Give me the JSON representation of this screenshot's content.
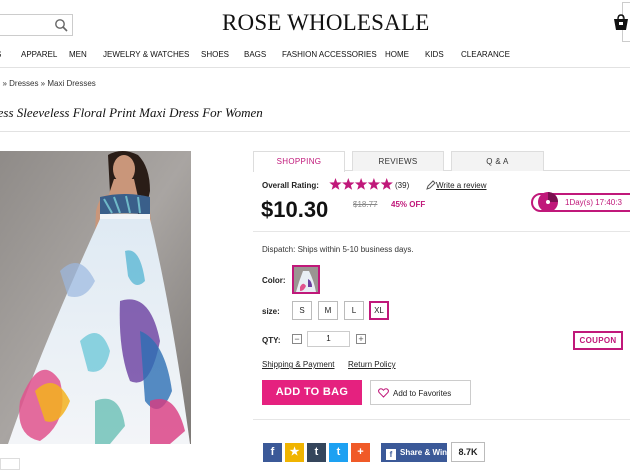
{
  "header": {
    "logo": "ROSE WHOLESALE",
    "search": {
      "value": "",
      "icon": "search-icon"
    },
    "cart": {
      "icon": "cart-icon"
    }
  },
  "nav": {
    "items": [
      "S",
      "APPAREL",
      "MEN",
      "JEWELRY & WATCHES",
      "SHOES",
      "BAGS",
      "FASHION ACCESSORIES",
      "HOME",
      "KIDS",
      "CLEARANCE"
    ]
  },
  "breadcrumb": "el » Dresses » Maxi Dresses",
  "product": {
    "title": "less Sleeveless Floral Print Maxi Dress For Women",
    "tabs": [
      {
        "label": "SHOPPING",
        "active": true
      },
      {
        "label": "REVIEWS",
        "active": false
      },
      {
        "label": "Q & A",
        "active": false
      }
    ],
    "rating": {
      "label": "Overall Rating:",
      "stars": 5,
      "count": "(39)",
      "write_review": "Write a review"
    },
    "price": "$10.30",
    "old_price": "$18.77",
    "discount": "45% OFF",
    "timer": "1Day(s) 17:40:3",
    "dispatch": "Dispatch: Ships within 5-10 business days.",
    "color_label": "Color:",
    "size_label": "size:",
    "sizes": [
      {
        "label": "S",
        "selected": false
      },
      {
        "label": "M",
        "selected": false
      },
      {
        "label": "L",
        "selected": false
      },
      {
        "label": "XL",
        "selected": true
      }
    ],
    "qty_label": "QTY:",
    "qty_value": "1",
    "qty_minus": "−",
    "qty_plus": "+",
    "coupon": "COUPON",
    "links": {
      "shipping": "Shipping & Payment",
      "return": "Return Policy"
    },
    "add_to_bag": "ADD TO BAG",
    "favorites": "Add to Favorites"
  },
  "social": {
    "buttons": [
      {
        "icon": "facebook-icon",
        "glyph": "f",
        "color": "#3b5998"
      },
      {
        "icon": "favorite-star-icon",
        "glyph": "★",
        "color": "#f0b400"
      },
      {
        "icon": "tumblr-icon",
        "glyph": "t",
        "color": "#35465c"
      },
      {
        "icon": "twitter-icon",
        "glyph": "t",
        "color": "#1da1f2"
      },
      {
        "icon": "plus-share-icon",
        "glyph": "+",
        "color": "#f05a28"
      }
    ],
    "share_win": "Share & Win",
    "share_count": "8.7K"
  },
  "colors": {
    "accent": "#c0187a",
    "button": "#e5217f",
    "facebook": "#3b5998"
  }
}
